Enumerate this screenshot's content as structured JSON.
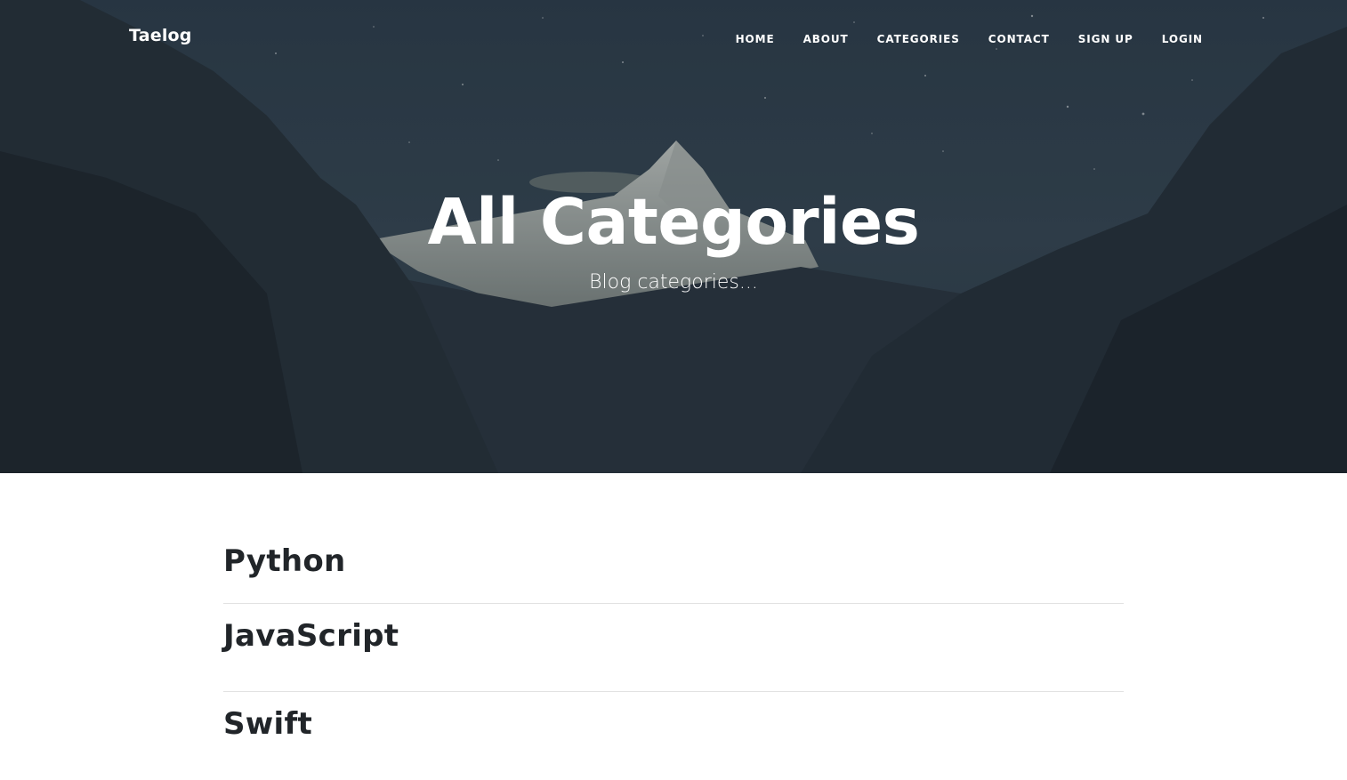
{
  "nav": {
    "brand": "Taelog",
    "links": [
      "HOME",
      "ABOUT",
      "CATEGORIES",
      "CONTACT",
      "SIGN UP",
      "LOGIN"
    ]
  },
  "header": {
    "title": "All Categories",
    "subtitle": "Blog categories..."
  },
  "categories": [
    "Python",
    "JavaScript",
    "Swift"
  ],
  "colors": {
    "text_dark": "#212529",
    "divider": "#e2e2e2",
    "overlay": "#2b3a48"
  }
}
